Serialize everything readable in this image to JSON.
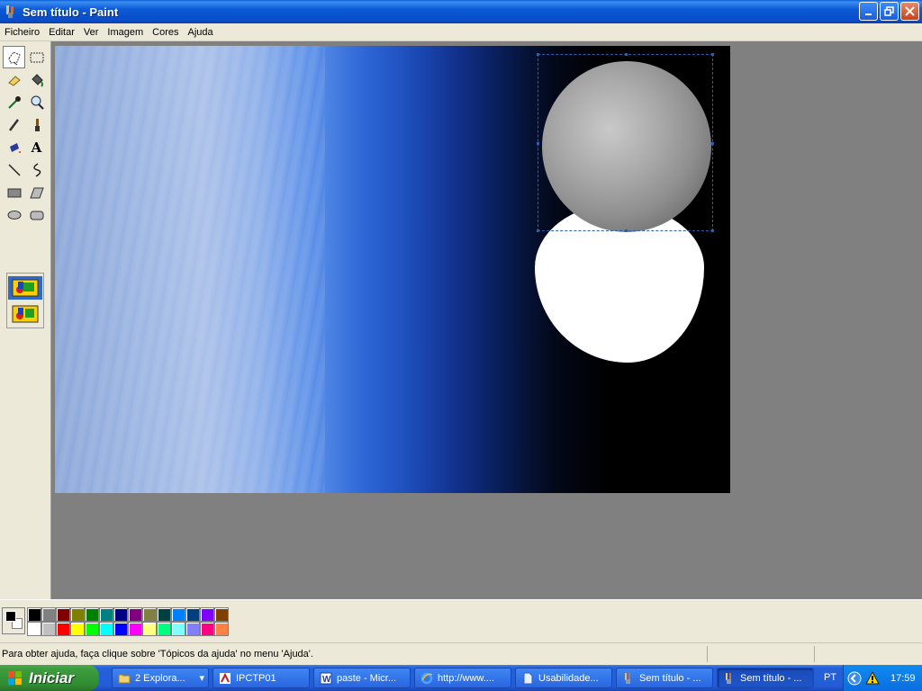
{
  "window": {
    "title": "Sem título - Paint"
  },
  "menu": [
    "Ficheiro",
    "Editar",
    "Ver",
    "Imagem",
    "Cores",
    "Ajuda"
  ],
  "tools": [
    {
      "name": "free-select-icon",
      "active": true
    },
    {
      "name": "rect-select-icon"
    },
    {
      "name": "eraser-icon"
    },
    {
      "name": "fill-icon"
    },
    {
      "name": "color-picker-icon"
    },
    {
      "name": "magnifier-icon"
    },
    {
      "name": "pencil-icon"
    },
    {
      "name": "brush-icon"
    },
    {
      "name": "airbrush-icon"
    },
    {
      "name": "text-icon"
    },
    {
      "name": "line-icon"
    },
    {
      "name": "curve-icon"
    },
    {
      "name": "rectangle-icon"
    },
    {
      "name": "polygon-icon"
    },
    {
      "name": "ellipse-icon"
    },
    {
      "name": "rounded-rect-icon"
    }
  ],
  "text_tool_glyph": "A",
  "palette": {
    "foreground": "#000000",
    "background": "#ffffff",
    "row1": [
      "#000000",
      "#808080",
      "#800000",
      "#808000",
      "#008000",
      "#008080",
      "#000080",
      "#800080",
      "#808040",
      "#004040",
      "#0080ff",
      "#004080",
      "#8000ff",
      "#804000"
    ],
    "row2": [
      "#ffffff",
      "#c0c0c0",
      "#ff0000",
      "#ffff00",
      "#00ff00",
      "#00ffff",
      "#0000ff",
      "#ff00ff",
      "#ffff80",
      "#00ff80",
      "#80ffff",
      "#8080ff",
      "#ff0080",
      "#ff8040"
    ]
  },
  "status": {
    "help": "Para obter ajuda, faça clique sobre 'Tópicos da ajuda' no menu 'Ajuda'."
  },
  "taskbar": {
    "start_label": "Iniciar",
    "tasks": [
      {
        "label": "2 Explora...",
        "icon": "folder-icon"
      },
      {
        "label": "IPCTP01",
        "icon": "acrobat-icon"
      },
      {
        "label": "paste - Micr...",
        "icon": "word-icon"
      },
      {
        "label": "http://www....",
        "icon": "ie-icon"
      },
      {
        "label": "Usabilidade...",
        "icon": "document-icon"
      },
      {
        "label": "Sem título - ...",
        "icon": "paint-icon"
      },
      {
        "label": "Sem título - ...",
        "icon": "paint-icon",
        "active": true
      }
    ],
    "language": "PT",
    "clock": "17:59"
  }
}
